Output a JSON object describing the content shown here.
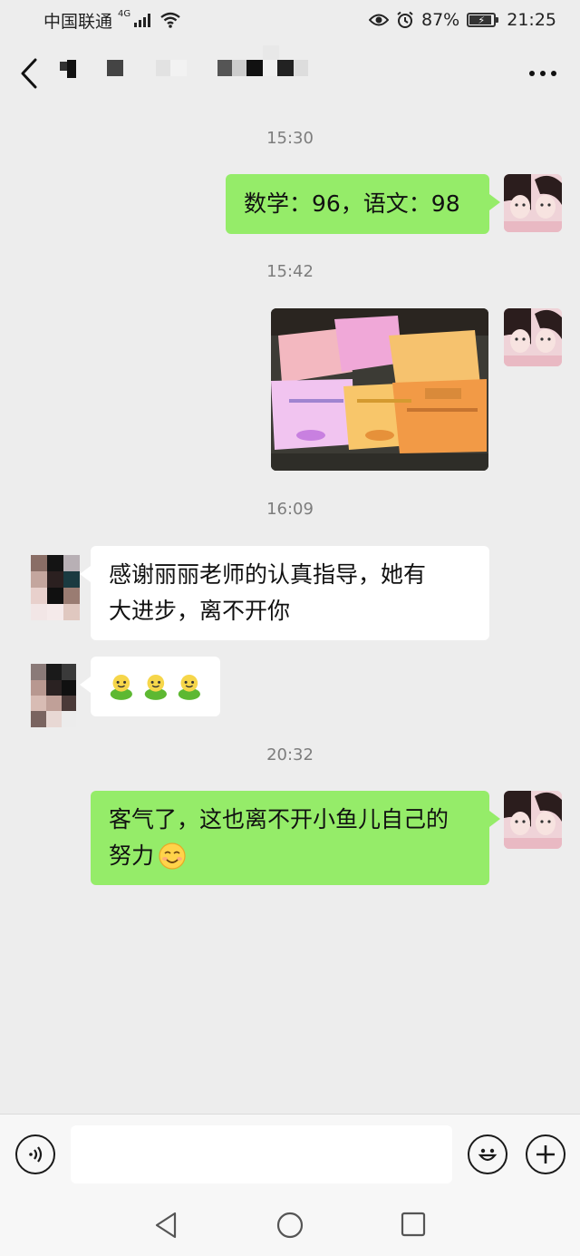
{
  "status_bar": {
    "carrier": "中国联通",
    "network": "4G",
    "battery": "87%",
    "time": "21:25"
  },
  "header": {
    "back_icon": "chevron-left-icon",
    "more_icon": "more-horizontal-icon"
  },
  "messages": [
    {
      "type": "time",
      "text": "15:30"
    },
    {
      "type": "text",
      "from": "me",
      "text": "数学：96，语文：98"
    },
    {
      "type": "time",
      "text": "15:42"
    },
    {
      "type": "image",
      "from": "me"
    },
    {
      "type": "time",
      "text": "16:09"
    },
    {
      "type": "text",
      "from": "other",
      "lines": [
        "感谢丽丽老师的认真指导，她有",
        "大进步，离不开你"
      ]
    },
    {
      "type": "emoji",
      "from": "other",
      "count": 3,
      "icon": "green-smiley-icon"
    },
    {
      "type": "time",
      "text": "20:32"
    },
    {
      "type": "text",
      "from": "me",
      "lines": [
        "客气了，这也离不开小鱼儿自己的",
        "努力"
      ],
      "trailing_icon": "smile-emoji-icon"
    }
  ],
  "input_bar": {
    "voice_icon": "voice-icon",
    "emoji_icon": "emoji-face-icon",
    "add_icon": "plus-icon",
    "value": ""
  },
  "nav_bar": {
    "back_icon": "triangle-back-icon",
    "home_icon": "circle-home-icon",
    "recent_icon": "square-recent-icon"
  },
  "colors": {
    "background": "#ededed",
    "outgoing_bubble": "#95ec69",
    "incoming_bubble": "#ffffff",
    "timestamp": "#7d7d7d"
  }
}
